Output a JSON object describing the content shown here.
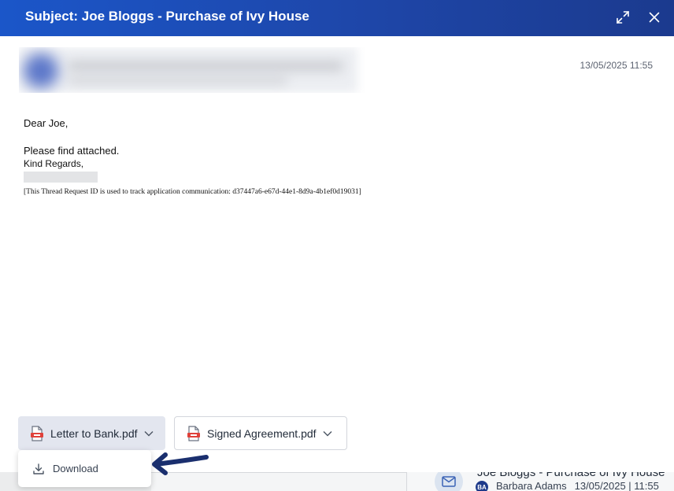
{
  "modal": {
    "title": "Subject: Joe Bloggs - Purchase of Ivy House",
    "expand_icon": "expand-icon",
    "close_icon": "close-icon"
  },
  "message": {
    "timestamp": "13/05/2025 11:55",
    "greeting": "Dear Joe,",
    "body": "Please find attached.",
    "signoff": "Kind Regards,",
    "thread_note": "[This Thread Request ID is used to track application communication: d37447a6-e67d-44e1-8d9a-4b1ef0d19031]"
  },
  "attachments": [
    {
      "name": "Letter to Bank.pdf",
      "icon": "pdf-icon",
      "selected": true
    },
    {
      "name": "Signed Agreement.pdf",
      "icon": "pdf-icon",
      "selected": false
    }
  ],
  "attachment_menu": {
    "items": [
      {
        "label": "Download",
        "icon": "download-icon"
      }
    ]
  },
  "background_thread": {
    "title": "Joe Bloggs - Purchase of Ivy House",
    "avatar_initials": "BA",
    "sender": "Barbara Adams",
    "timestamp": "13/05/2025 | 11:55"
  },
  "colors": {
    "header_start": "#1b56c9",
    "header_end": "#1b3a8e",
    "annotation_arrow": "#1a2f6e",
    "selected_attachment_bg": "#e3e6ef",
    "pdf_red": "#e0413a"
  }
}
